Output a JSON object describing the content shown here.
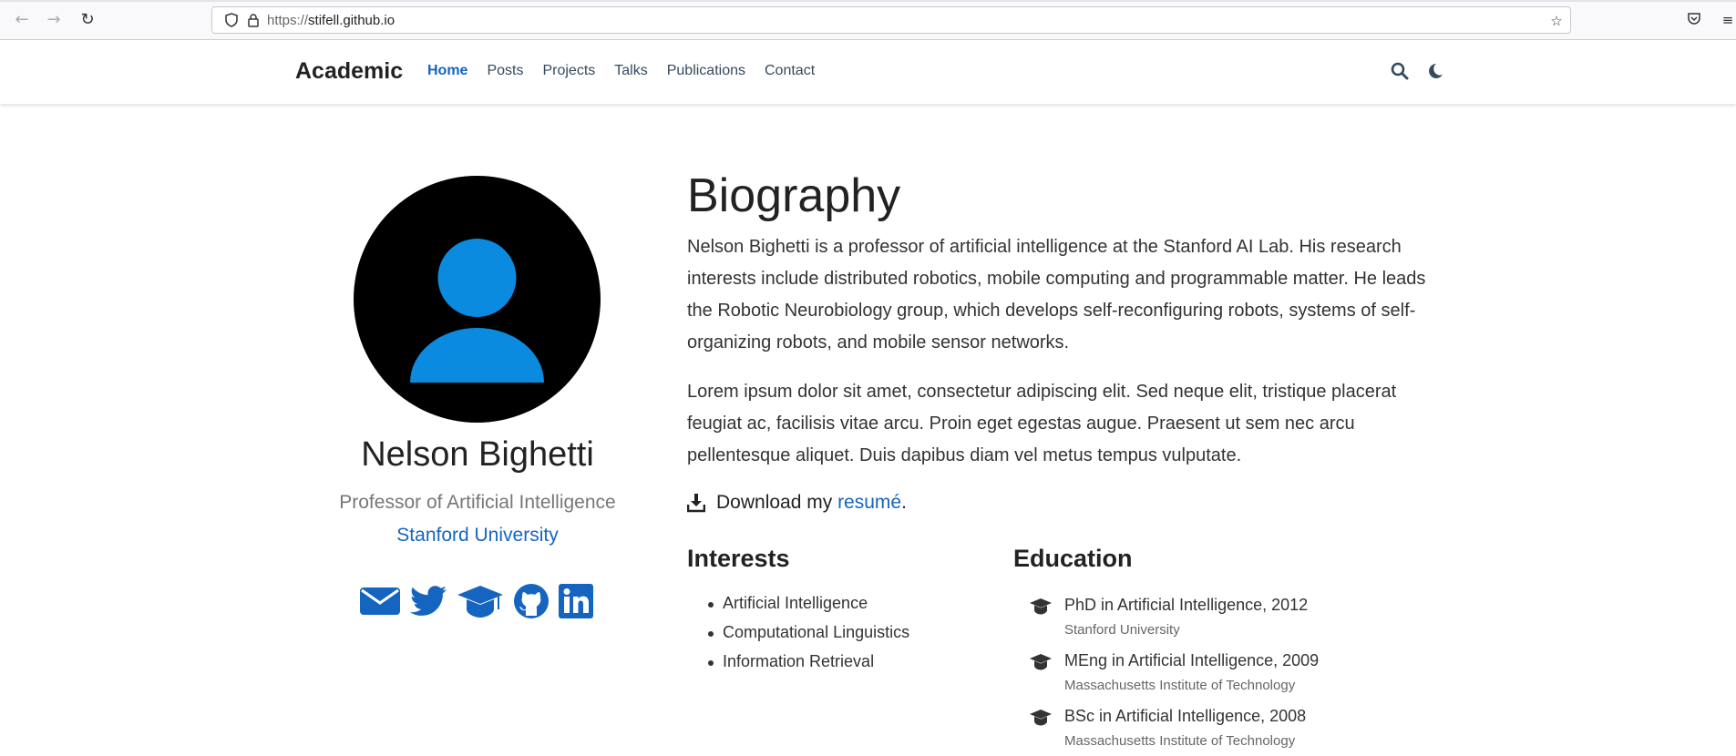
{
  "browser": {
    "url_scheme": "https://",
    "url_host": "stifell.github.io"
  },
  "nav": {
    "brand": "Academic",
    "links": [
      {
        "label": "Home",
        "active": true
      },
      {
        "label": "Posts",
        "active": false
      },
      {
        "label": "Projects",
        "active": false
      },
      {
        "label": "Talks",
        "active": false
      },
      {
        "label": "Publications",
        "active": false
      },
      {
        "label": "Contact",
        "active": false
      }
    ],
    "icons": [
      "search-icon",
      "moon-icon"
    ]
  },
  "profile": {
    "name": "Nelson Bighetti",
    "role": "Professor of Artificial Intelligence",
    "organization": "Stanford University",
    "avatar_colors": {
      "background": "#000000",
      "figure": "#0a8be0"
    },
    "social_icons": [
      "envelope-icon",
      "twitter-icon",
      "graduation-cap-icon",
      "github-icon",
      "linkedin-icon"
    ],
    "social_color": "#1565c0"
  },
  "biography": {
    "heading": "Biography",
    "paragraphs": [
      "Nelson Bighetti is a professor of artificial intelligence at the Stanford AI Lab. His research interests include distributed robotics, mobile computing and programmable matter. He leads the Robotic Neurobiology group, which develops self-reconfiguring robots, systems of self-organizing robots, and mobile sensor networks.",
      "Lorem ipsum dolor sit amet, consectetur adipiscing elit. Sed neque elit, tristique placerat feugiat ac, facilisis vitae arcu. Proin eget egestas augue. Praesent ut sem nec arcu pellentesque aliquet. Duis dapibus diam vel metus tempus vulputate."
    ],
    "download_prefix": "Download my ",
    "download_link": "resumé",
    "download_suffix": "."
  },
  "interests": {
    "heading": "Interests",
    "items": [
      "Artificial Intelligence",
      "Computational Linguistics",
      "Information Retrieval"
    ]
  },
  "education": {
    "heading": "Education",
    "items": [
      {
        "course": "PhD in Artificial Intelligence, 2012",
        "institution": "Stanford University"
      },
      {
        "course": "MEng in Artificial Intelligence, 2009",
        "institution": "Massachusetts Institute of Technology"
      },
      {
        "course": "BSc in Artificial Intelligence, 2008",
        "institution": "Massachusetts Institute of Technology"
      }
    ]
  },
  "colors": {
    "accent": "#1565c0",
    "text": "#333333"
  }
}
